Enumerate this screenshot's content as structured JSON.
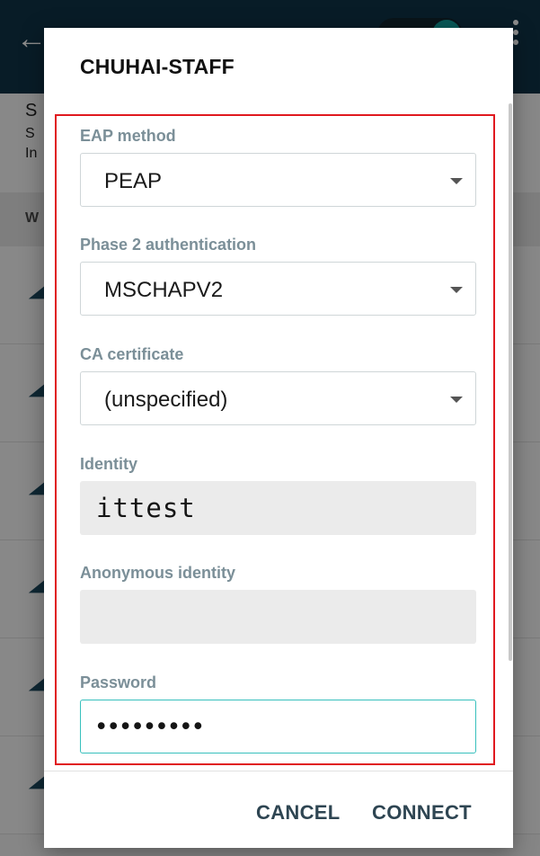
{
  "dialog": {
    "title": "CHUHAI-STAFF",
    "fields": {
      "eap_method": {
        "label": "EAP method",
        "value": "PEAP"
      },
      "phase2": {
        "label": "Phase 2 authentication",
        "value": "MSCHAPV2"
      },
      "ca_cert": {
        "label": "CA certificate",
        "value": "(unspecified)"
      },
      "identity": {
        "label": "Identity",
        "value": "ittest"
      },
      "anonymous_identity": {
        "label": "Anonymous identity",
        "value": ""
      },
      "password": {
        "label": "Password",
        "value": "•••••••••"
      }
    },
    "actions": {
      "cancel": "CANCEL",
      "connect": "CONNECT"
    }
  },
  "background": {
    "section_letter_1": "S",
    "section_letter_2": "S",
    "section_letter_3": "In",
    "subheader_letter": "W"
  },
  "colors": {
    "appbar": "#0f3448",
    "accent": "#37c0bd",
    "label": "#7b8f98",
    "highlight": "#e0191f"
  },
  "icons": {
    "back": "arrow-back-icon",
    "wifi": "wifi-icon",
    "dropdown": "chevron-down-icon",
    "overflow": "more-vert-icon"
  }
}
